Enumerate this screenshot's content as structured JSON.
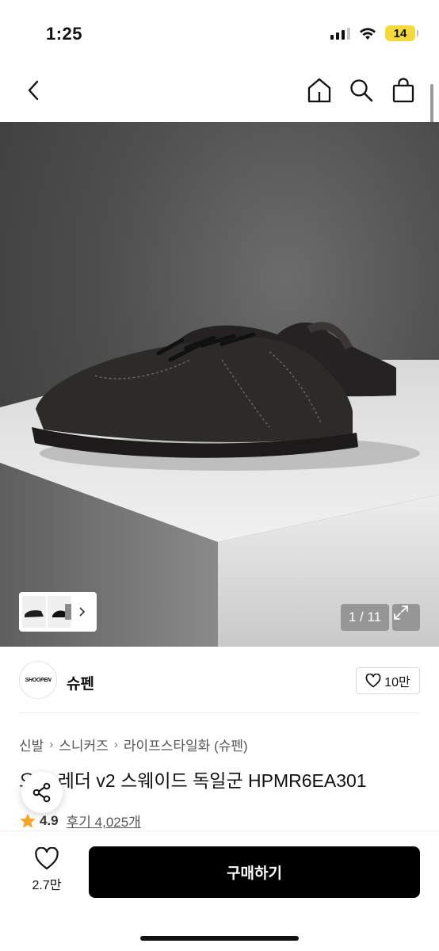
{
  "status_bar": {
    "time": "1:25",
    "battery": "14",
    "battery_color": "#f4d93a"
  },
  "nav": {
    "back_icon": "chevron-left-icon",
    "home_icon": "home-icon",
    "search_icon": "search-icon",
    "cart_icon": "shopping-bag-icon"
  },
  "gallery": {
    "counter": "1 / 11",
    "expand_icon": "expand-icon",
    "thumbnail_icon": "chevron-right-icon"
  },
  "brand": {
    "logo_text": "SHOOPEN",
    "name": "슈펜",
    "likes": "10만"
  },
  "breadcrumb": [
    "신발",
    "스니커즈",
    "라이프스타일화 (슈펜)"
  ],
  "product": {
    "title": "오드 레더 v2 스웨이드 독일군 HPMR6EA301",
    "rating": "4.9",
    "reviews": "후기 4,025개"
  },
  "bottom_bar": {
    "wish_count": "2.7만",
    "buy_label": "구매하기"
  },
  "colors": {
    "accent": "#000000",
    "star": "#f5a623"
  }
}
